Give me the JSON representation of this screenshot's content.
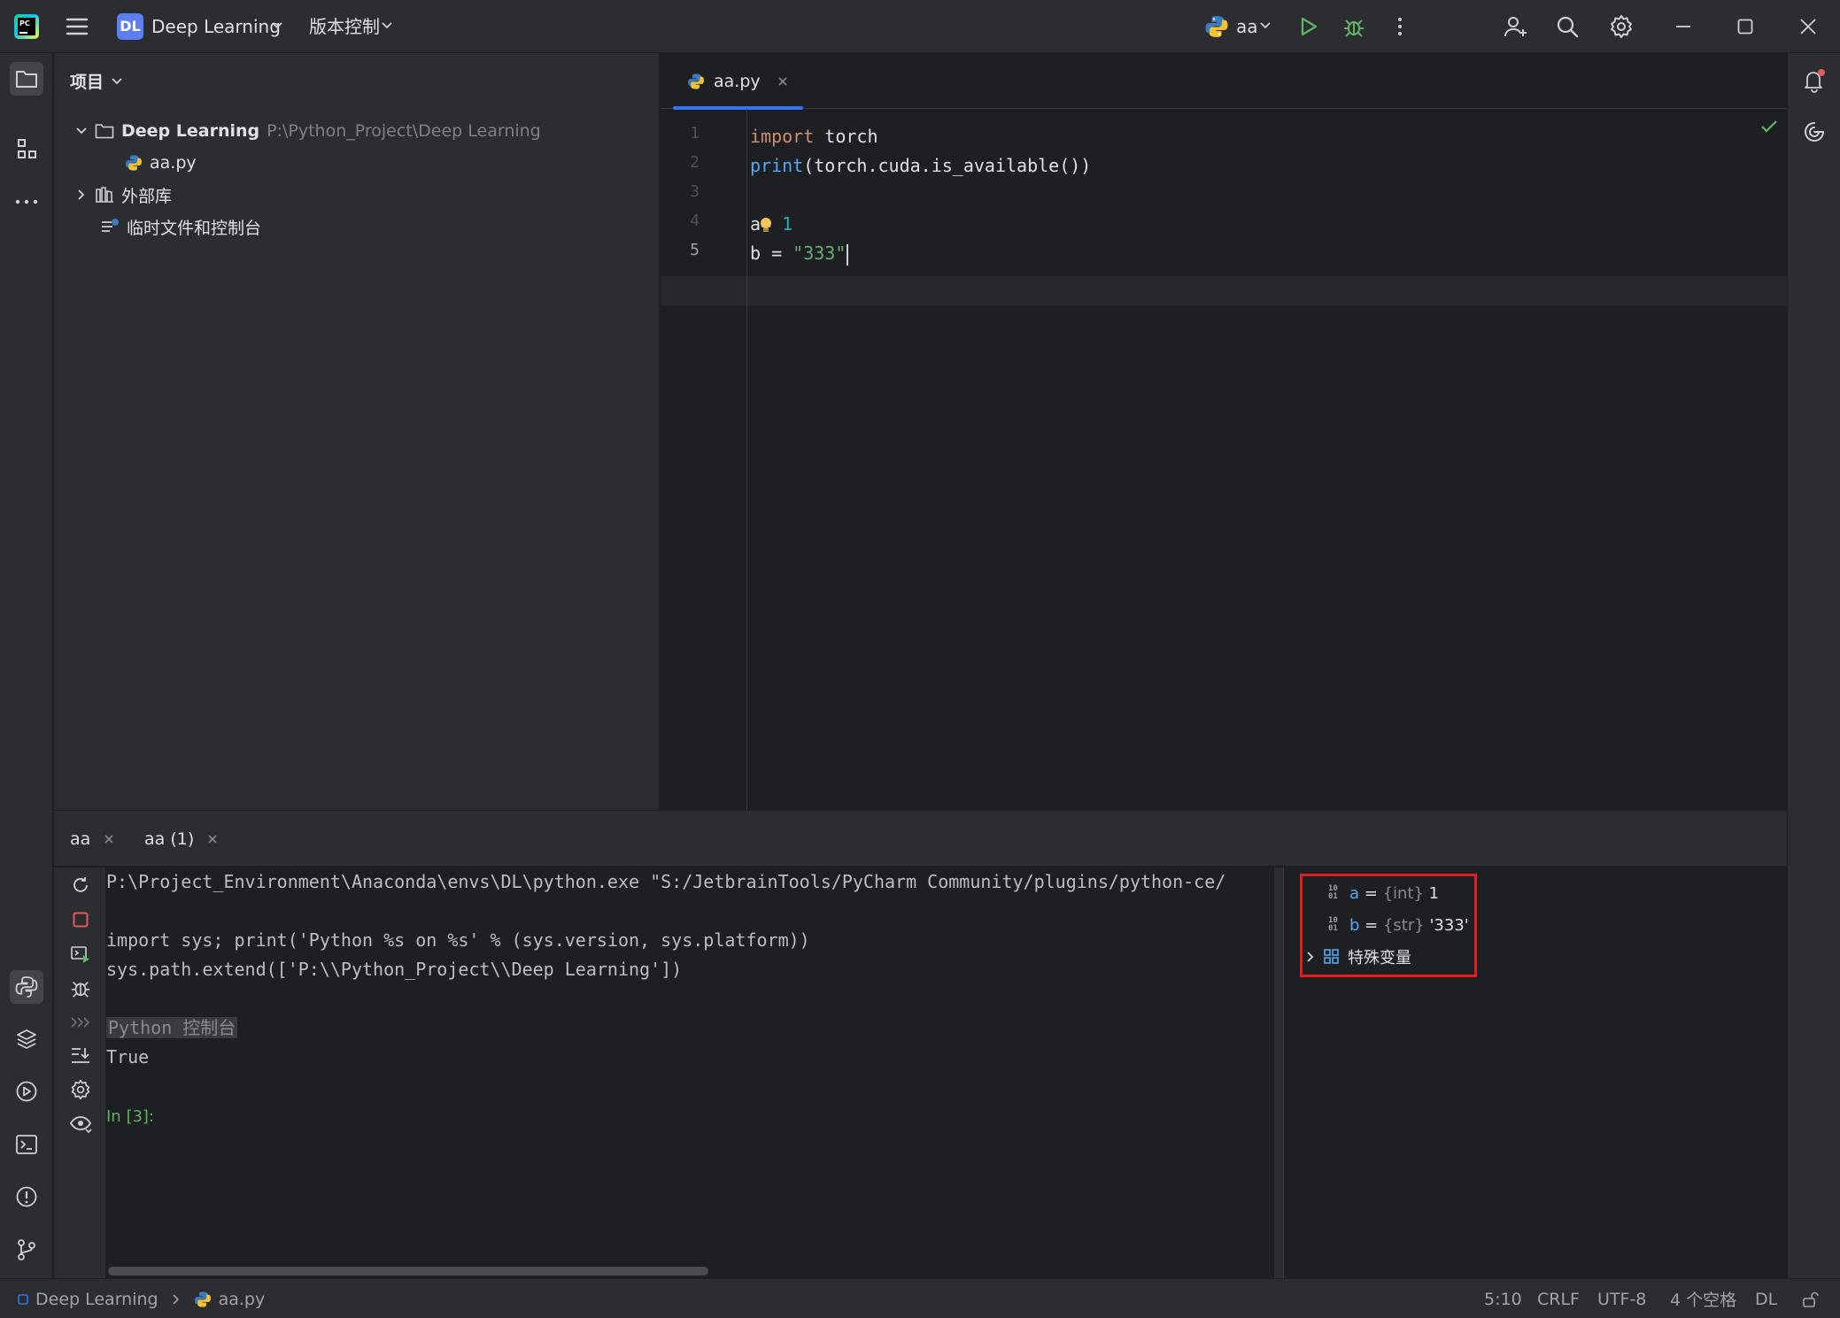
{
  "titlebar": {
    "project_badge": "DL",
    "project_name": "Deep Learning",
    "vcs_menu": "版本控制",
    "run_config": "aa"
  },
  "project_panel": {
    "title": "项目",
    "root_name": "Deep Learning",
    "root_path": "P:\\Python_Project\\Deep Learning",
    "file": "aa.py",
    "external_libs": "外部库",
    "scratches": "临时文件和控制台"
  },
  "editor": {
    "tab_label": "aa.py",
    "line_numbers": [
      "1",
      "2",
      "3",
      "4",
      "5"
    ],
    "code": {
      "l1_kw": "import",
      "l1_rest": " torch",
      "l2_fn": "print",
      "l2_rest": "(torch.cuda.is_available())",
      "l4_a": "a",
      "l4_eq": "= ",
      "l4_num": "1",
      "l5_b": "b = ",
      "l5_str": "\"333\""
    }
  },
  "console": {
    "tabs": [
      "aa",
      "aa (1)"
    ],
    "lines": {
      "cmd": "P:\\Project_Environment\\Anaconda\\envs\\DL\\python.exe \"S:/JetbrainTools/PyCharm Community/plugins/python-ce/",
      "import_line": "import sys; print('Python %s on %s' % (sys.version, sys.platform))",
      "path_line": "sys.path.extend(['P:\\\\Python_Project\\\\Deep Learning'])",
      "console_label": "Python 控制台",
      "output": "True",
      "prompt": "In [3]:"
    },
    "variables": [
      {
        "name": "a",
        "eq": " = ",
        "type": "{int}",
        "value": "1"
      },
      {
        "name": "b",
        "eq": " = ",
        "type": "{str}",
        "value": "'333'"
      }
    ],
    "special_vars": "特殊变量"
  },
  "statusbar": {
    "breadcrumb_project": "Deep Learning",
    "breadcrumb_file": "aa.py",
    "position": "5:10",
    "line_sep": "CRLF",
    "encoding": "UTF-8",
    "indent": "4 个空格",
    "interpreter": "DL"
  },
  "colors": {
    "accent": "#3574f0",
    "highlight_box": "#e01e24",
    "run_green": "#5fb865",
    "keyword": "#cf8e6d",
    "function": "#56a8f5",
    "number": "#2aacb8",
    "string": "#6aab73"
  }
}
